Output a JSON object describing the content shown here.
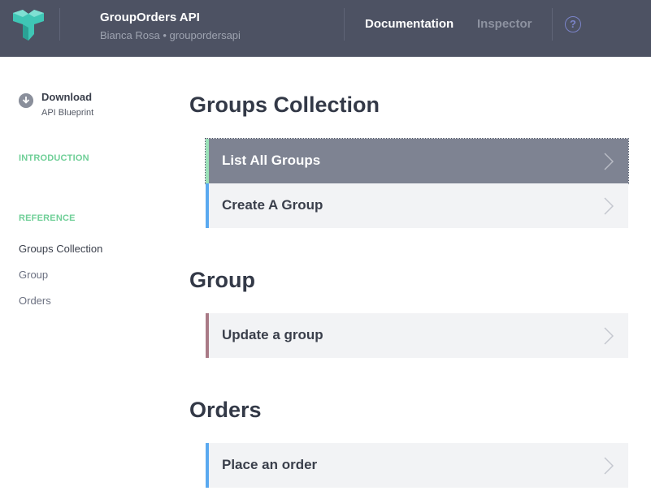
{
  "header": {
    "app_title": "GroupOrders API",
    "app_subtitle": "Bianca Rosa • groupordersapi",
    "nav": {
      "documentation": "Documentation",
      "inspector": "Inspector"
    },
    "help_glyph": "?",
    "icons": {
      "logo": "apiary-logo-icon",
      "help": "help-circle-icon"
    },
    "colors": {
      "background": "#4d5263",
      "logo": "#3fc6b5",
      "help": "#7b84c9"
    }
  },
  "sidebar": {
    "download": {
      "title": "Download",
      "subtitle": "API Blueprint",
      "icon": "download-icon"
    },
    "introduction_heading": "INTRODUCTION",
    "reference_heading": "REFERENCE",
    "items": [
      {
        "label": "Groups Collection",
        "active": true
      },
      {
        "label": "Group",
        "active": false
      },
      {
        "label": "Orders",
        "active": false
      }
    ]
  },
  "main": {
    "sections": [
      {
        "title": "Groups Collection",
        "actions": [
          {
            "label": "List All Groups",
            "selected": true,
            "color": "#9be2b9"
          },
          {
            "label": "Create A Group",
            "selected": false,
            "color": "#5aa9f0"
          }
        ]
      },
      {
        "title": "Group",
        "actions": [
          {
            "label": "Update a group",
            "selected": false,
            "color": "#a97a86"
          }
        ]
      },
      {
        "title": "Orders",
        "actions": [
          {
            "label": "Place an order",
            "selected": false,
            "color": "#5aa9f0"
          }
        ]
      }
    ]
  }
}
